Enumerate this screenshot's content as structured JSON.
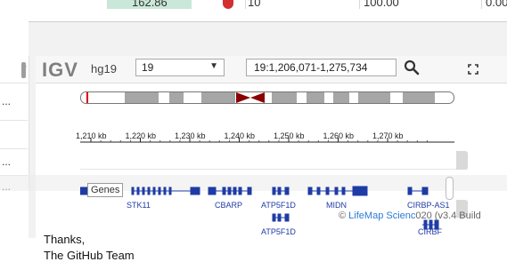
{
  "background": {
    "top_values": [
      "162.86",
      "10",
      "100.00",
      "0.00"
    ],
    "footer_lines": [
      "Thanks,",
      "The GitHub Team"
    ]
  },
  "gutter": {
    "header": "#",
    "rows": [
      "...",
      "...",
      "..."
    ]
  },
  "igv": {
    "logo": "IGV",
    "genome": "hg19",
    "chromosome": "19",
    "locus": "19:1,206,071-1,275,734",
    "ruler_ticks": [
      "1,210 kb",
      "1,220 kb",
      "1,230 kb",
      "1,240 kb",
      "1,250 kb",
      "1,260 kb",
      "1,270 kb"
    ],
    "track_label": "Genes",
    "genes": [
      "STK11",
      "CBARP",
      "ATP5F1D",
      "MIDN",
      "CIRBP-AS1",
      "ATP5F1D",
      "CIRBF"
    ],
    "credit_prefix": "©",
    "credit_link": "LifeMap Scienc",
    "credit_suffix": "020 (v3.4 Build"
  },
  "colors": {
    "gene": "#1f3ba5",
    "centromere": "#8b0000",
    "ideogram_band": "#a6a6a6"
  }
}
